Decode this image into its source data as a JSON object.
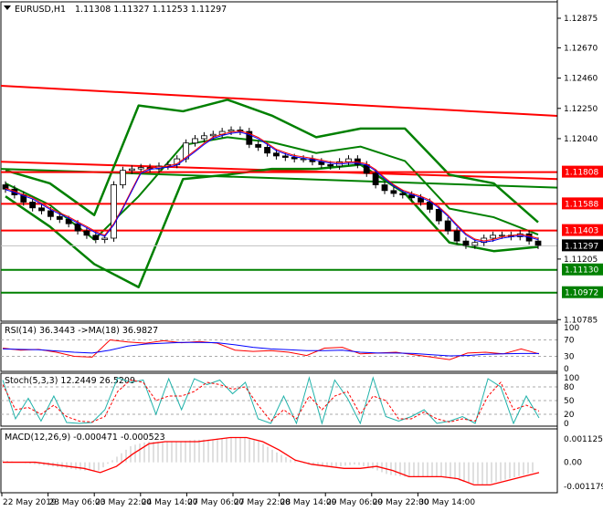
{
  "header": {
    "symbol": "EURUSD,H1",
    "ohlc": "1.11308 1.11327 1.11253 1.11297"
  },
  "colors": {
    "bull": "#000000",
    "bear": "#000000",
    "bands": "#008000",
    "resistance": "#ff0000",
    "support": "#008000",
    "rsi": "#ff0000",
    "rsi_ma": "#0000ff",
    "stoch_main": "#20b2aa",
    "stoch_signal": "#ff0000",
    "macd": "#ff0000",
    "hist": "#c0c0c0"
  },
  "chart_data": [
    {
      "type": "candlestick",
      "title": "EURUSD,H1",
      "ylim": [
        1.10774,
        1.12989
      ],
      "y_ticks": [
        "1.12875",
        "1.12670",
        "1.12460",
        "1.12250",
        "1.12040",
        "1.11205",
        "1.10785"
      ],
      "y_tick_values": [
        1.12875,
        1.1267,
        1.1246,
        1.1225,
        1.1204,
        1.11205,
        1.10785
      ],
      "closes": [
        1.1169,
        1.1165,
        1.116,
        1.1156,
        1.1154,
        1.115,
        1.1148,
        1.1145,
        1.114,
        1.1137,
        1.1134,
        1.1135,
        1.1172,
        1.1182,
        1.1183,
        1.1184,
        1.1183,
        1.1185,
        1.1186,
        1.119,
        1.1201,
        1.1204,
        1.1206,
        1.1207,
        1.1209,
        1.121,
        1.1209,
        1.12,
        1.1198,
        1.1194,
        1.1192,
        1.1191,
        1.119,
        1.119,
        1.1188,
        1.1186,
        1.1185,
        1.1188,
        1.119,
        1.1186,
        1.118,
        1.1172,
        1.1168,
        1.1166,
        1.1165,
        1.1163,
        1.116,
        1.1155,
        1.1147,
        1.114,
        1.1133,
        1.113,
        1.1132,
        1.1135,
        1.1137,
        1.1137,
        1.1136,
        1.1138,
        1.1133,
        1.113
      ],
      "bollinger_upper": [
        1.1182,
        1.1173,
        1.1151,
        1.1227,
        1.1223,
        1.1231,
        1.122,
        1.1205,
        1.1211,
        1.1211,
        1.1179,
        1.1173,
        1.1146
      ],
      "bollinger_lower": [
        1.1164,
        1.1143,
        1.1117,
        1.1101,
        1.1176,
        1.1179,
        1.1183,
        1.1183,
        1.1186,
        1.1166,
        1.1132,
        1.1126,
        1.1129
      ],
      "trend_line": [
        1.12407,
        1.12198
      ],
      "slow_ma_red": [
        1.1188,
        1.1176
      ],
      "slow_ma_green": [
        1.1183,
        1.117
      ],
      "levels": [
        {
          "price": 1.11808,
          "label": "1.11808",
          "kind": "resistance"
        },
        {
          "price": 1.11588,
          "label": "1.11588",
          "kind": "resistance"
        },
        {
          "price": 1.11403,
          "label": "1.11403",
          "kind": "resistance"
        },
        {
          "price": 1.11297,
          "label": "1.11297",
          "kind": "current"
        },
        {
          "price": 1.1113,
          "label": "1.11130",
          "kind": "support"
        },
        {
          "price": 1.10972,
          "label": "1.10972",
          "kind": "support"
        }
      ]
    },
    {
      "type": "line",
      "title": "RSI(14) 36.3443  ->MA(18) 36.9827",
      "ylim": [
        0,
        100
      ],
      "y_ticks": [
        "100",
        "70",
        "30",
        "0"
      ],
      "series": [
        {
          "name": "RSI",
          "values": [
            50,
            45,
            47,
            40,
            30,
            28,
            70,
            65,
            62,
            68,
            63,
            66,
            62,
            45,
            42,
            44,
            40,
            32,
            50,
            52,
            36,
            38,
            40,
            34,
            28,
            22,
            38,
            40,
            36,
            48,
            36
          ]
        },
        {
          "name": "MA",
          "values": [
            48,
            47,
            46,
            43,
            40,
            38,
            45,
            55,
            60,
            62,
            64,
            64,
            63,
            58,
            52,
            48,
            46,
            44,
            44,
            45,
            40,
            38,
            38,
            37,
            34,
            31,
            32,
            35,
            36,
            37,
            37
          ]
        }
      ]
    },
    {
      "type": "line",
      "title": "Stoch(5,3,3) 12.2449 26.5209",
      "ylim": [
        0,
        100
      ],
      "y_ticks": [
        "100",
        "80",
        "50",
        "20",
        "0"
      ],
      "series": [
        {
          "name": "main",
          "values": [
            95,
            10,
            55,
            5,
            60,
            2,
            0,
            2,
            30,
            100,
            90,
            95,
            20,
            98,
            30,
            98,
            85,
            95,
            65,
            90,
            10,
            0,
            60,
            0,
            100,
            0,
            95,
            55,
            0,
            100,
            15,
            5,
            15,
            30,
            0,
            5,
            15,
            0,
            98,
            80,
            0,
            60,
            12
          ]
        },
        {
          "name": "signal",
          "values": [
            85,
            30,
            35,
            20,
            40,
            15,
            5,
            3,
            15,
            70,
            95,
            90,
            50,
            60,
            60,
            70,
            90,
            85,
            75,
            80,
            40,
            5,
            30,
            10,
            60,
            30,
            60,
            70,
            20,
            60,
            50,
            10,
            10,
            25,
            10,
            3,
            10,
            5,
            60,
            90,
            30,
            40,
            27
          ]
        }
      ]
    },
    {
      "type": "bar+line",
      "title": "MACD(12,26,9) -0.000471 -0.000523",
      "ylim": [
        -0.00135,
        0.0014
      ],
      "y_ticks": [
        "0.001125",
        "0.00",
        "-0.001179"
      ],
      "y_tick_values": [
        0.001125,
        0,
        -0.001179
      ],
      "histogram": [
        0.0001,
        0.0,
        -0.0001,
        -0.0002,
        -0.0003,
        -0.0004,
        -0.0004,
        0.0002,
        0.0008,
        0.001,
        0.001,
        0.001,
        0.0011,
        0.0011,
        0.0012,
        0.0012,
        0.001,
        0.0005,
        0.0001,
        -0.0001,
        -0.0002,
        -0.0002,
        -0.0001,
        -0.0003,
        -0.0006,
        -0.0007,
        -0.0007,
        -0.0007,
        -0.0008,
        -0.001,
        -0.0011,
        -0.0009,
        -0.0007,
        -0.0005
      ],
      "signal": [
        0.0,
        0.0,
        0.0,
        -0.0001,
        -0.0002,
        -0.0003,
        -0.0005,
        -0.0002,
        0.0004,
        0.0009,
        0.001,
        0.001,
        0.001,
        0.0011,
        0.0012,
        0.0012,
        0.001,
        0.0006,
        0.0001,
        -0.0001,
        -0.0002,
        -0.0003,
        -0.0003,
        -0.0002,
        -0.0004,
        -0.0007,
        -0.0007,
        -0.0007,
        -0.0008,
        -0.0011,
        -0.0011,
        -0.0009,
        -0.0007,
        -0.0005
      ]
    }
  ],
  "time_axis": [
    "22 May 2019",
    "23 May 06:00",
    "23 May 22:00",
    "24 May 14:00",
    "27 May 06:00",
    "27 May 22:00",
    "28 May 14:00",
    "29 May 06:00",
    "29 May 22:00",
    "30 May 14:00"
  ]
}
